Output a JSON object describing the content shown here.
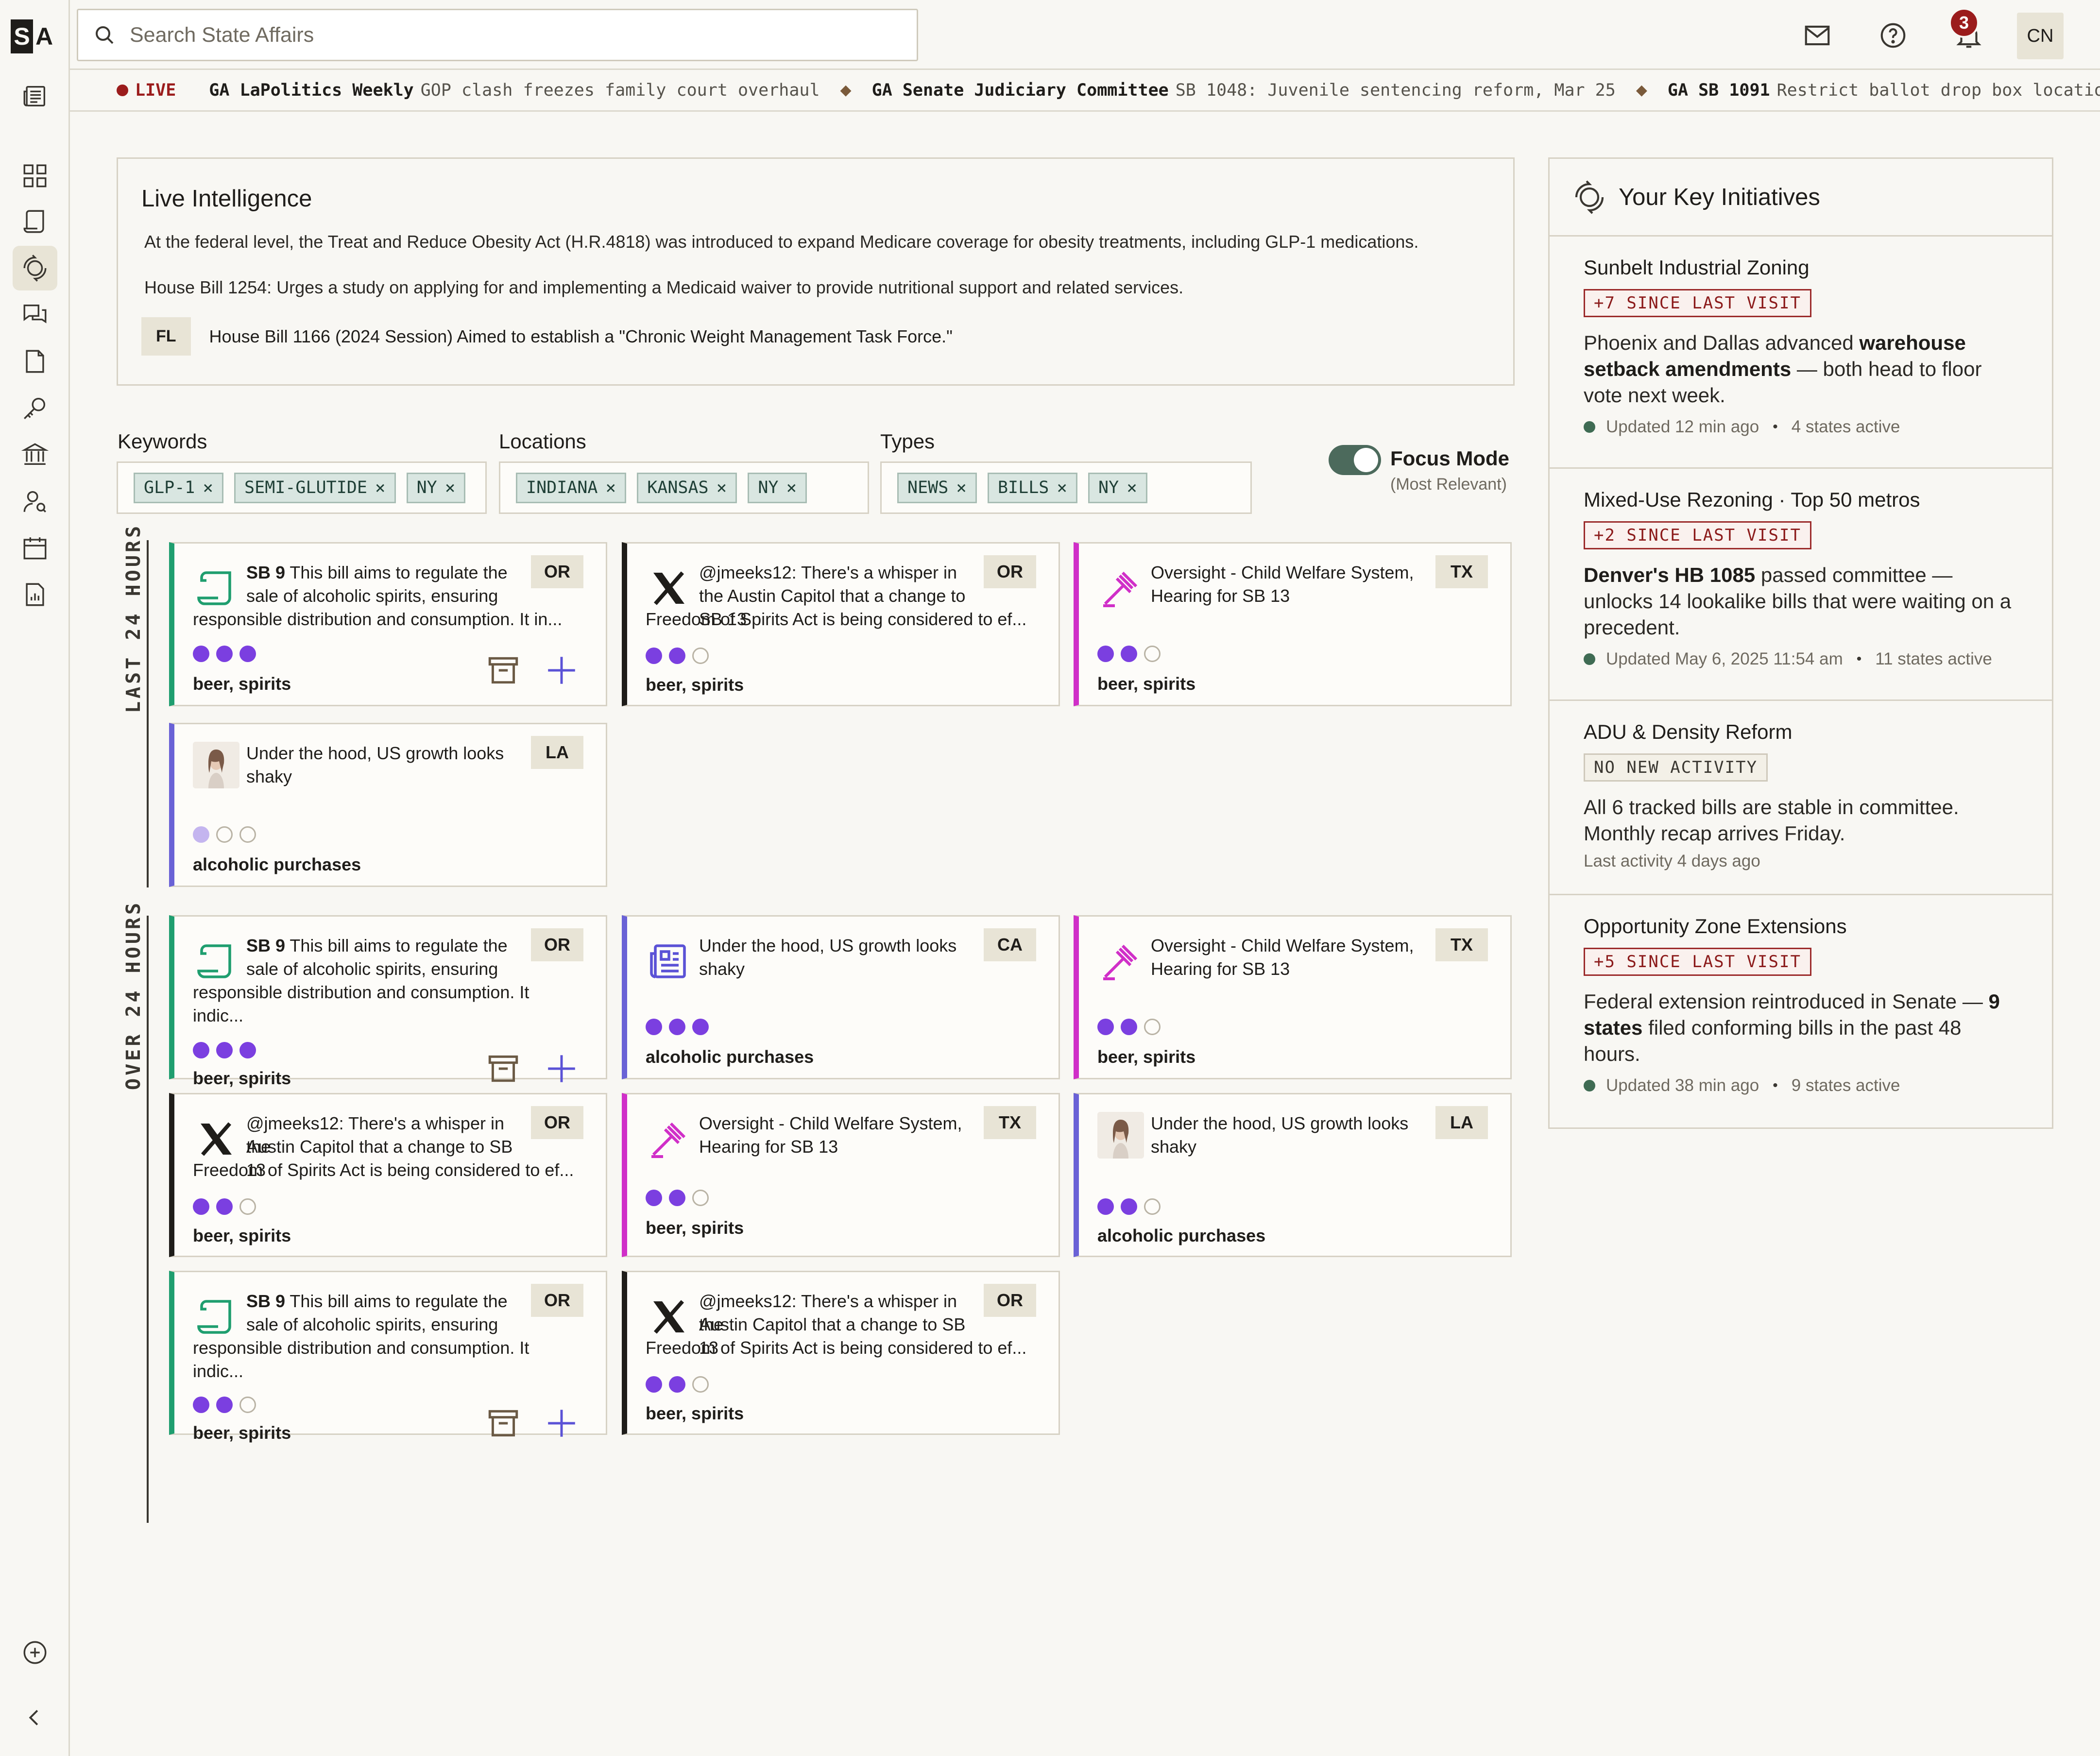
{
  "brand": {
    "s": "S",
    "a": "A"
  },
  "search": {
    "placeholder": "Search State Affairs"
  },
  "header": {
    "notification_count": "3",
    "avatar_initials": "CN"
  },
  "ticker": {
    "live_label": "LIVE",
    "items": [
      {
        "title": "GA LaPolitics Weekly",
        "text": "GOP clash freezes family court overhaul"
      },
      {
        "title": "GA Senate Judiciary Committee",
        "text": "SB 1048: Juvenile sentencing reform, Mar 25"
      },
      {
        "title": "GA SB 1091",
        "text": "Restrict ballot drop box locations"
      }
    ]
  },
  "live_intel": {
    "title": "Live Intelligence",
    "p1": "At the federal level, the Treat and Reduce Obesity Act (H.R.4818) was introduced to expand Medicare coverage for obesity treatments, including GLP-1 medications.",
    "p2": "House Bill 1254: Urges a study on applying for and implementing a Medicaid waiver to provide nutritional support and related services.",
    "p3_tag": "FL",
    "p3": "House Bill 1166 (2024 Session) Aimed to establish a \"Chronic Weight Management Task Force.\""
  },
  "filters": {
    "keywords_label": "Keywords",
    "keywords": [
      "GLP-1",
      "SEMI-GLUTIDE",
      "NY"
    ],
    "locations_label": "Locations",
    "locations": [
      "INDIANA",
      "KANSAS",
      "NY"
    ],
    "types_label": "Types",
    "types": [
      "NEWS",
      "BILLS",
      "NY"
    ],
    "focus_label": "Focus Mode",
    "focus_sub": "(Most Relevant)",
    "focus_on": true
  },
  "sections": {
    "last24": "LAST 24 HOURS",
    "over24": "OVER 24 HOURS"
  },
  "cards": {
    "bill_a": {
      "state": "OR",
      "bold": "SB 9",
      "text": "This bill aims to regulate the sale of alcoholic spirits, ensuring",
      "cont": "responsible distribution and consumption. It in...",
      "tags": "beer, spirits"
    },
    "social": {
      "state": "OR",
      "text": "@jmeeks12: There's a whisper in the Austin Capitol that a change to SB 13",
      "cont": "Freedom of Spirits Act is being considered to ef...",
      "tags": "beer, spirits"
    },
    "hearing_tx": {
      "state": "TX",
      "text": "Oversight - Child Welfare System, Hearing for SB 13",
      "tags": "beer, spirits"
    },
    "news_la": {
      "state": "LA",
      "text": "Under the hood, US growth looks shaky",
      "tags": "alcoholic purchases"
    },
    "bill_b": {
      "state": "OR",
      "bold": "SB 9",
      "text": "This bill aims to regulate the sale of alcoholic spirits, ensuring",
      "cont": "responsible distribution and consumption. It indic...",
      "tags": "beer, spirits"
    },
    "news_ca": {
      "state": "CA",
      "text": "Under the hood, US growth looks shaky",
      "tags": "alcoholic purchases"
    },
    "social_b_line1": "@jmeeks12: There's a whisper in the",
    "social_b_line2": "Austin Capitol that a change to SB 13",
    "social_b_cont": "Freedom of Spirits Act is being considered to ef..."
  },
  "initiatives": {
    "title": "Your Key Initiatives",
    "items": [
      {
        "name": "Sunbelt Industrial Zoning",
        "badge": "+7 SINCE LAST VISIT",
        "body_pre": "Phoenix and Dallas advanced ",
        "body_bold": "warehouse setback amendments",
        "body_post": " — both head to floor vote next week.",
        "updated": "Updated 12 min ago",
        "states": "4 states active"
      },
      {
        "name": "Mixed-Use Rezoning · Top 50 metros",
        "badge": "+2 SINCE LAST VISIT",
        "body_bold": "Denver's HB 1085",
        "body_post": " passed committee — unlocks 14 lookalike bills that were waiting on a precedent.",
        "updated": "Updated May 6, 2025 11:54 am",
        "states": "11 states active"
      },
      {
        "name": "ADU & Density Reform",
        "badge": "NO NEW ACTIVITY",
        "body": "All 6 tracked bills are stable in committee. Monthly recap arrives Friday.",
        "last": "Last activity 4 days ago"
      },
      {
        "name": "Opportunity Zone Extensions",
        "badge": "+5 SINCE LAST VISIT",
        "body_pre": "Federal extension reintroduced in Senate — ",
        "body_bold": "9 states",
        "body_post": " filed conforming bills in the past 48 hours.",
        "updated": "Updated 38 min ago",
        "states": "9 states active"
      }
    ]
  },
  "colors": {
    "bill": "#1f9e6f",
    "social": "#1f1d1a",
    "hearing": "#d02fc8",
    "news": "#6a62d6",
    "dots": "#7b3fe0",
    "alert": "#9b1c1c"
  }
}
